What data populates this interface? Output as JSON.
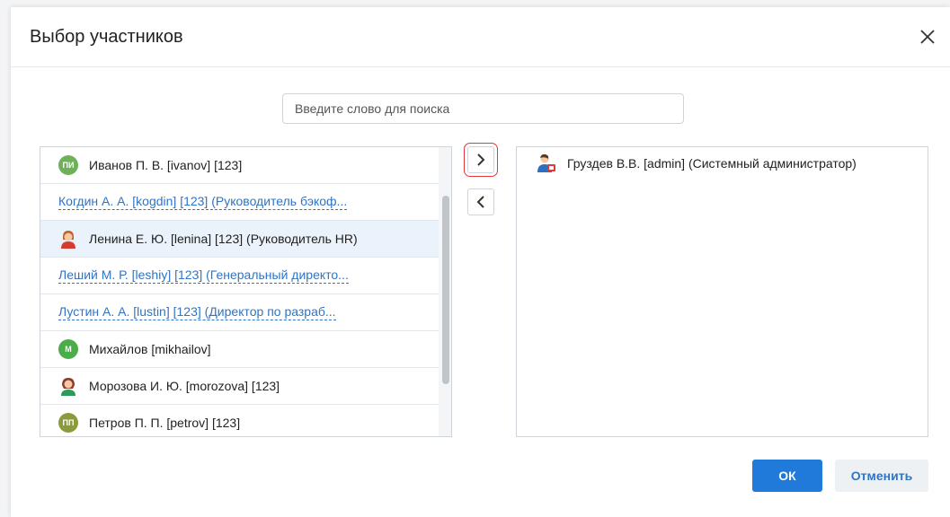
{
  "dialog": {
    "title": "Выбор участников",
    "close_icon": "close-icon"
  },
  "search": {
    "placeholder": "Введите слово для поиска",
    "value": ""
  },
  "available": {
    "items": [
      {
        "label": "Иванов П. В. [ivanov] [123]",
        "avatar": "ПИ",
        "avatar_color": "#6fb05a",
        "kind": "initials",
        "style": "plain"
      },
      {
        "label": "Когдин А. А. [kogdin] [123] (Руководитель бэкоф...",
        "kind": "none",
        "style": "link"
      },
      {
        "label": "Ленина Е. Ю. [lenina] [123] (Руководитель HR)",
        "kind": "person-female-icon",
        "style": "plain",
        "selected": true
      },
      {
        "label": "Леший М. Р. [leshiy] [123] (Генеральный директо...",
        "kind": "none",
        "style": "link"
      },
      {
        "label": "Лустин А. А. [lustin] [123] (Директор по разраб...",
        "kind": "none",
        "style": "link"
      },
      {
        "label": "Михайлов [mikhailov]",
        "avatar": "М",
        "avatar_color": "#4aad4a",
        "kind": "initials",
        "style": "plain"
      },
      {
        "label": "Морозова И. Ю. [morozova] [123]",
        "kind": "person-female-icon",
        "style": "plain"
      },
      {
        "label": "Петров П. П. [petrov] [123]",
        "avatar": "ПП",
        "avatar_color": "#8a9a3c",
        "kind": "initials",
        "style": "plain"
      }
    ]
  },
  "selected": {
    "items": [
      {
        "label": "Груздев В.В. [admin] (Системный администратор)",
        "kind": "admin-user-icon"
      }
    ]
  },
  "buttons": {
    "add_icon": "chevron-right-icon",
    "remove_icon": "chevron-left-icon",
    "ok_label": "ОК",
    "cancel_label": "Отменить"
  },
  "colors": {
    "accent": "#1f7ad9",
    "link": "#2f74c6",
    "selected_row": "#eaf2fb",
    "focus_outline": "#e0393e"
  }
}
